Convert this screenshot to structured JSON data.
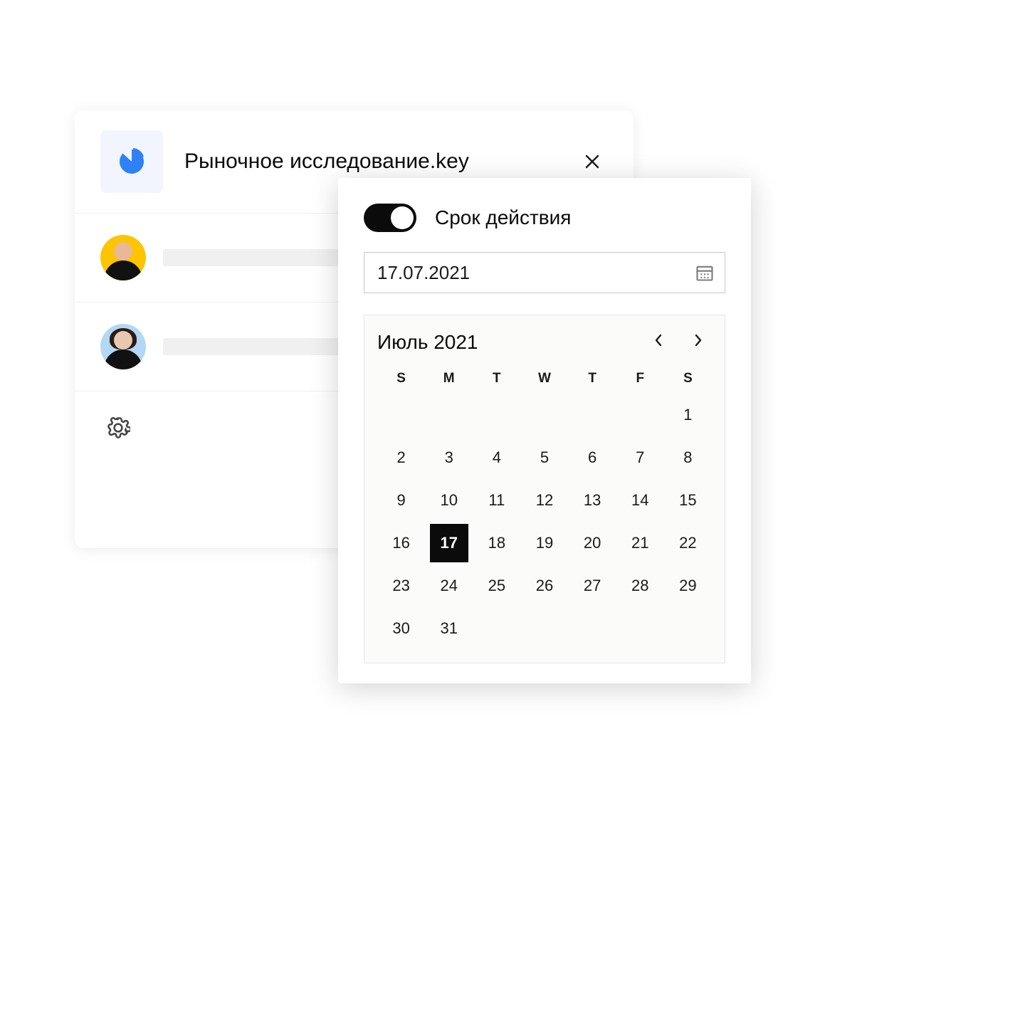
{
  "share": {
    "file_title": "Рыночное исследование.key",
    "users": [
      {
        "avatar_bg": "#fdc400"
      },
      {
        "avatar_bg": "#b3d7f5"
      }
    ]
  },
  "expiry": {
    "toggle_on": true,
    "label": "Срок действия",
    "date_value": "17.07.2021"
  },
  "calendar": {
    "month_label": "Июль 2021",
    "dow": [
      "S",
      "M",
      "T",
      "W",
      "T",
      "F",
      "S"
    ],
    "leading_blanks": 6,
    "days_in_month": 31,
    "selected_day": 17
  }
}
